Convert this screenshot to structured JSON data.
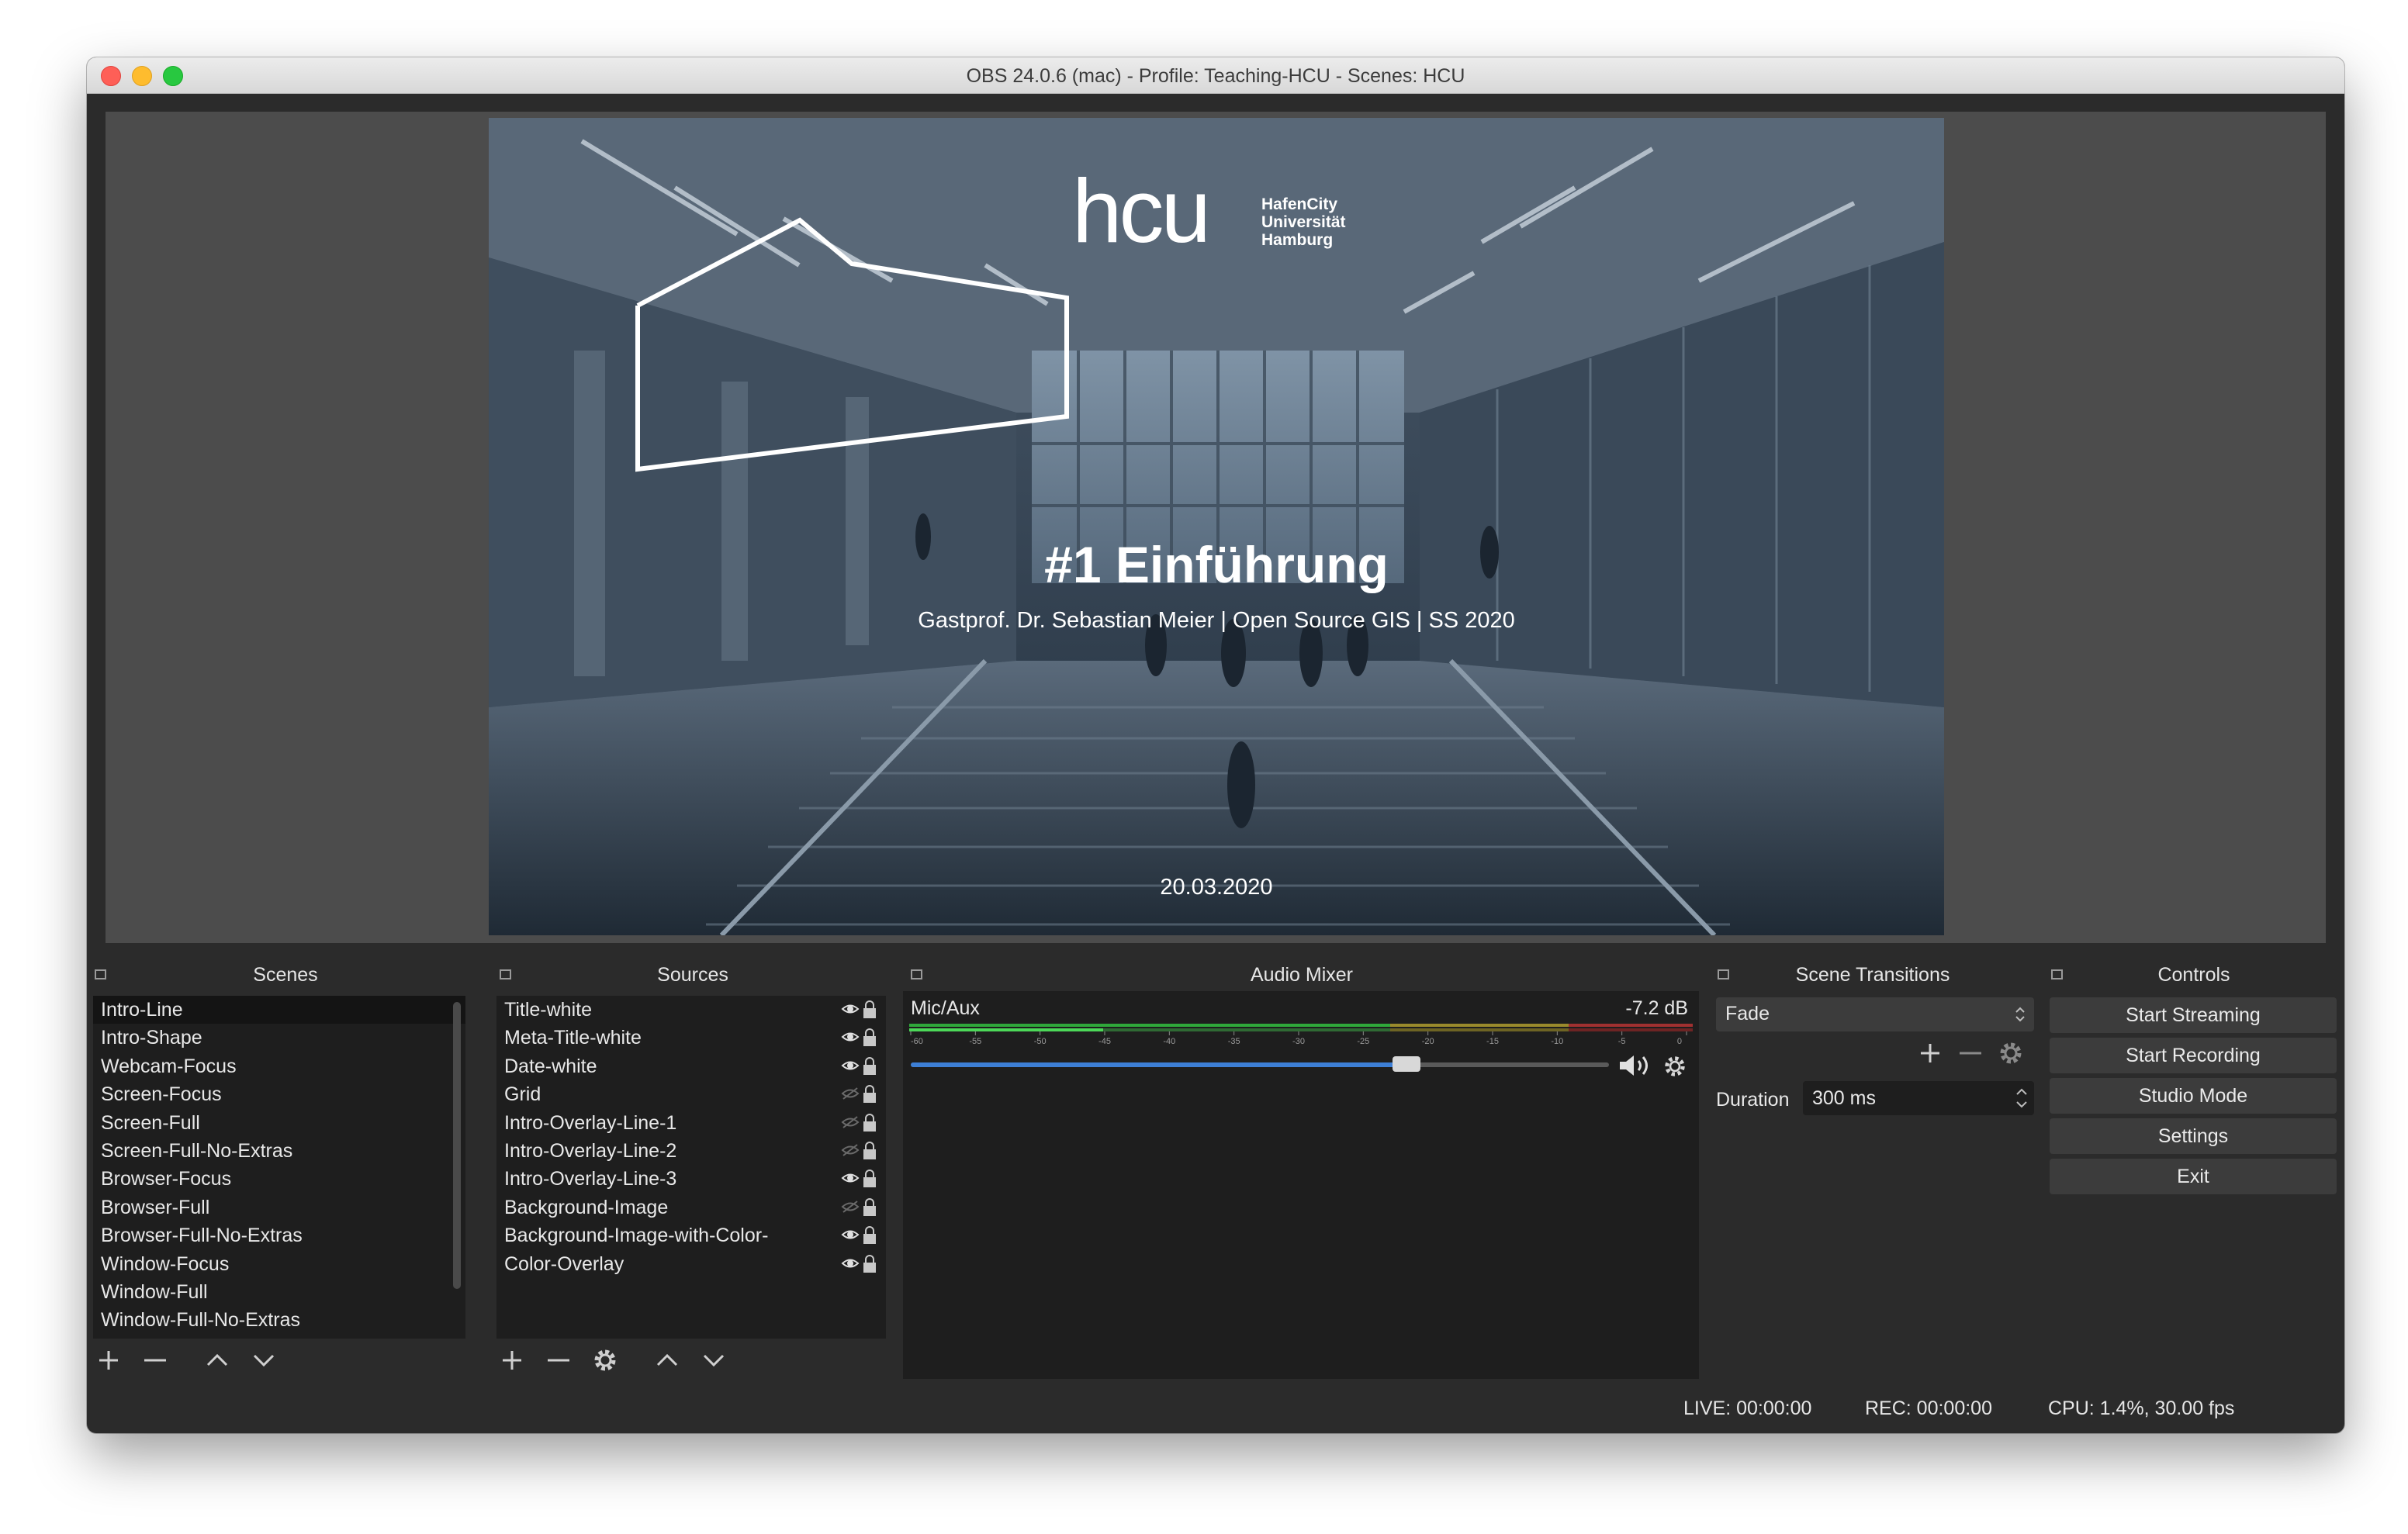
{
  "window": {
    "title": "OBS 24.0.6 (mac) - Profile: Teaching-HCU - Scenes: HCU"
  },
  "preview": {
    "logo_text": "hcu",
    "logo_lines": [
      "HafenCity",
      "Universität",
      "Hamburg"
    ],
    "slide_title": "#1 Einführung",
    "slide_subtitle": "Gastprof. Dr. Sebastian Meier | Open Source GIS | SS 2020",
    "slide_date": "20.03.2020"
  },
  "scenes": {
    "header": "Scenes",
    "items": [
      {
        "label": "Intro-Line",
        "selected": true
      },
      {
        "label": "Intro-Shape"
      },
      {
        "label": "Webcam-Focus"
      },
      {
        "label": "Screen-Focus"
      },
      {
        "label": "Screen-Full"
      },
      {
        "label": "Screen-Full-No-Extras"
      },
      {
        "label": "Browser-Focus"
      },
      {
        "label": "Browser-Full"
      },
      {
        "label": "Browser-Full-No-Extras"
      },
      {
        "label": "Window-Focus"
      },
      {
        "label": "Window-Full"
      },
      {
        "label": "Window-Full-No-Extras"
      }
    ]
  },
  "sources": {
    "header": "Sources",
    "items": [
      {
        "label": "Title-white",
        "visible": true
      },
      {
        "label": "Meta-Title-white",
        "visible": true
      },
      {
        "label": "Date-white",
        "visible": true
      },
      {
        "label": "Grid",
        "visible": false
      },
      {
        "label": "Intro-Overlay-Line-1",
        "visible": false
      },
      {
        "label": "Intro-Overlay-Line-2",
        "visible": false
      },
      {
        "label": "Intro-Overlay-Line-3",
        "visible": true
      },
      {
        "label": "Background-Image",
        "visible": false
      },
      {
        "label": "Background-Image-with-Color-",
        "visible": true
      },
      {
        "label": "Color-Overlay",
        "visible": true
      }
    ]
  },
  "audio_mixer": {
    "header": "Audio Mixer",
    "channel": "Mic/Aux",
    "level": "-7.2 dB",
    "scale_labels": [
      "-60",
      "-55",
      "-50",
      "-45",
      "-40",
      "-35",
      "-30",
      "-25",
      "-20",
      "-15",
      "-10",
      "-5",
      "0"
    ],
    "volume_fraction": 0.71
  },
  "transitions": {
    "header": "Scene Transitions",
    "selected": "Fade",
    "duration_label": "Duration",
    "duration_value": "300 ms"
  },
  "controls": {
    "header": "Controls",
    "buttons": [
      "Start Streaming",
      "Start Recording",
      "Studio Mode",
      "Settings",
      "Exit"
    ]
  },
  "status_bar": {
    "live": "LIVE: 00:00:00",
    "rec": "REC: 00:00:00",
    "cpu": "CPU: 1.4%, 30.00 fps"
  },
  "colors": {
    "panel_bg": "#2b2b2b",
    "list_bg": "#1e1e1e",
    "button_bg": "#3c3c3c",
    "volume_blue": "#3d7fd6"
  },
  "icons": [
    "float-icon",
    "eye-icon",
    "eye-hidden-icon",
    "lock-icon",
    "plus-icon",
    "minus-icon",
    "gear-icon",
    "arrow-up-icon",
    "arrow-down-icon",
    "speaker-icon",
    "updown-chevron-icon"
  ]
}
